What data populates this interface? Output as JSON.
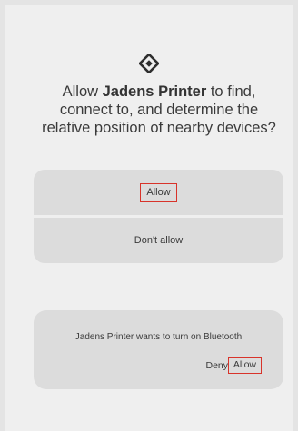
{
  "permission_dialog": {
    "icon": "nearby-devices-icon",
    "title_prefix": "Allow ",
    "app_name": "Jadens Printer",
    "title_suffix": " to find, connect to, and determine the relative position of nearby devices?",
    "allow_label": "Allow",
    "deny_label": "Don't allow"
  },
  "bluetooth_dialog": {
    "message": "Jadens Printer wants to turn on Bluetooth",
    "deny_label": "Deny",
    "allow_label": "Allow"
  },
  "colors": {
    "highlight_outline": "#d8332a",
    "card_background": "#dcdcdc",
    "screen_background": "#efefef"
  }
}
